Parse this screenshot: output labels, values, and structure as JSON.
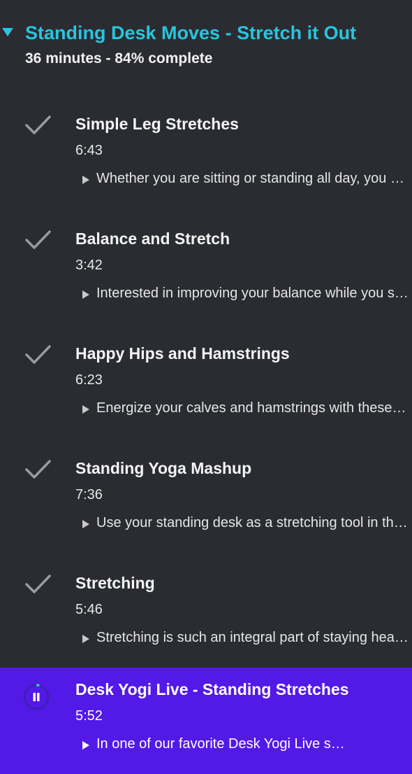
{
  "course": {
    "title": "Standing Desk Moves - Stretch it Out",
    "meta": "36 minutes - 84% complete",
    "accent_color": "#29c4de"
  },
  "lessons": [
    {
      "title": "Simple Leg Stretches",
      "duration": "6:43",
      "description": "Whether you are sitting or standing all day, you can take a few moments to stretch your legs",
      "status": "complete"
    },
    {
      "title": "Balance and Stretch",
      "duration": "3:42",
      "description": "Interested in improving your balance while you stretch at your desk",
      "status": "complete"
    },
    {
      "title": "Happy Hips and Hamstrings",
      "duration": "6:23",
      "description": "Energize your calves and hamstrings with these simple moves",
      "status": "complete"
    },
    {
      "title": "Standing Yoga Mashup",
      "duration": "7:36",
      "description": "Use your standing desk as a stretching tool in this yoga mashup",
      "status": "complete"
    },
    {
      "title": "Stretching",
      "duration": "5:46",
      "description": "Stretching is such an integral part of staying healthy at work",
      "status": "complete"
    },
    {
      "title": "Desk Yogi Live - Standing Stretches",
      "duration": "5:52",
      "description": "In one of our favorite Desk Yogi Live sessions, we stretch together",
      "status": "playing",
      "highlight_color": "#5319e7"
    }
  ]
}
